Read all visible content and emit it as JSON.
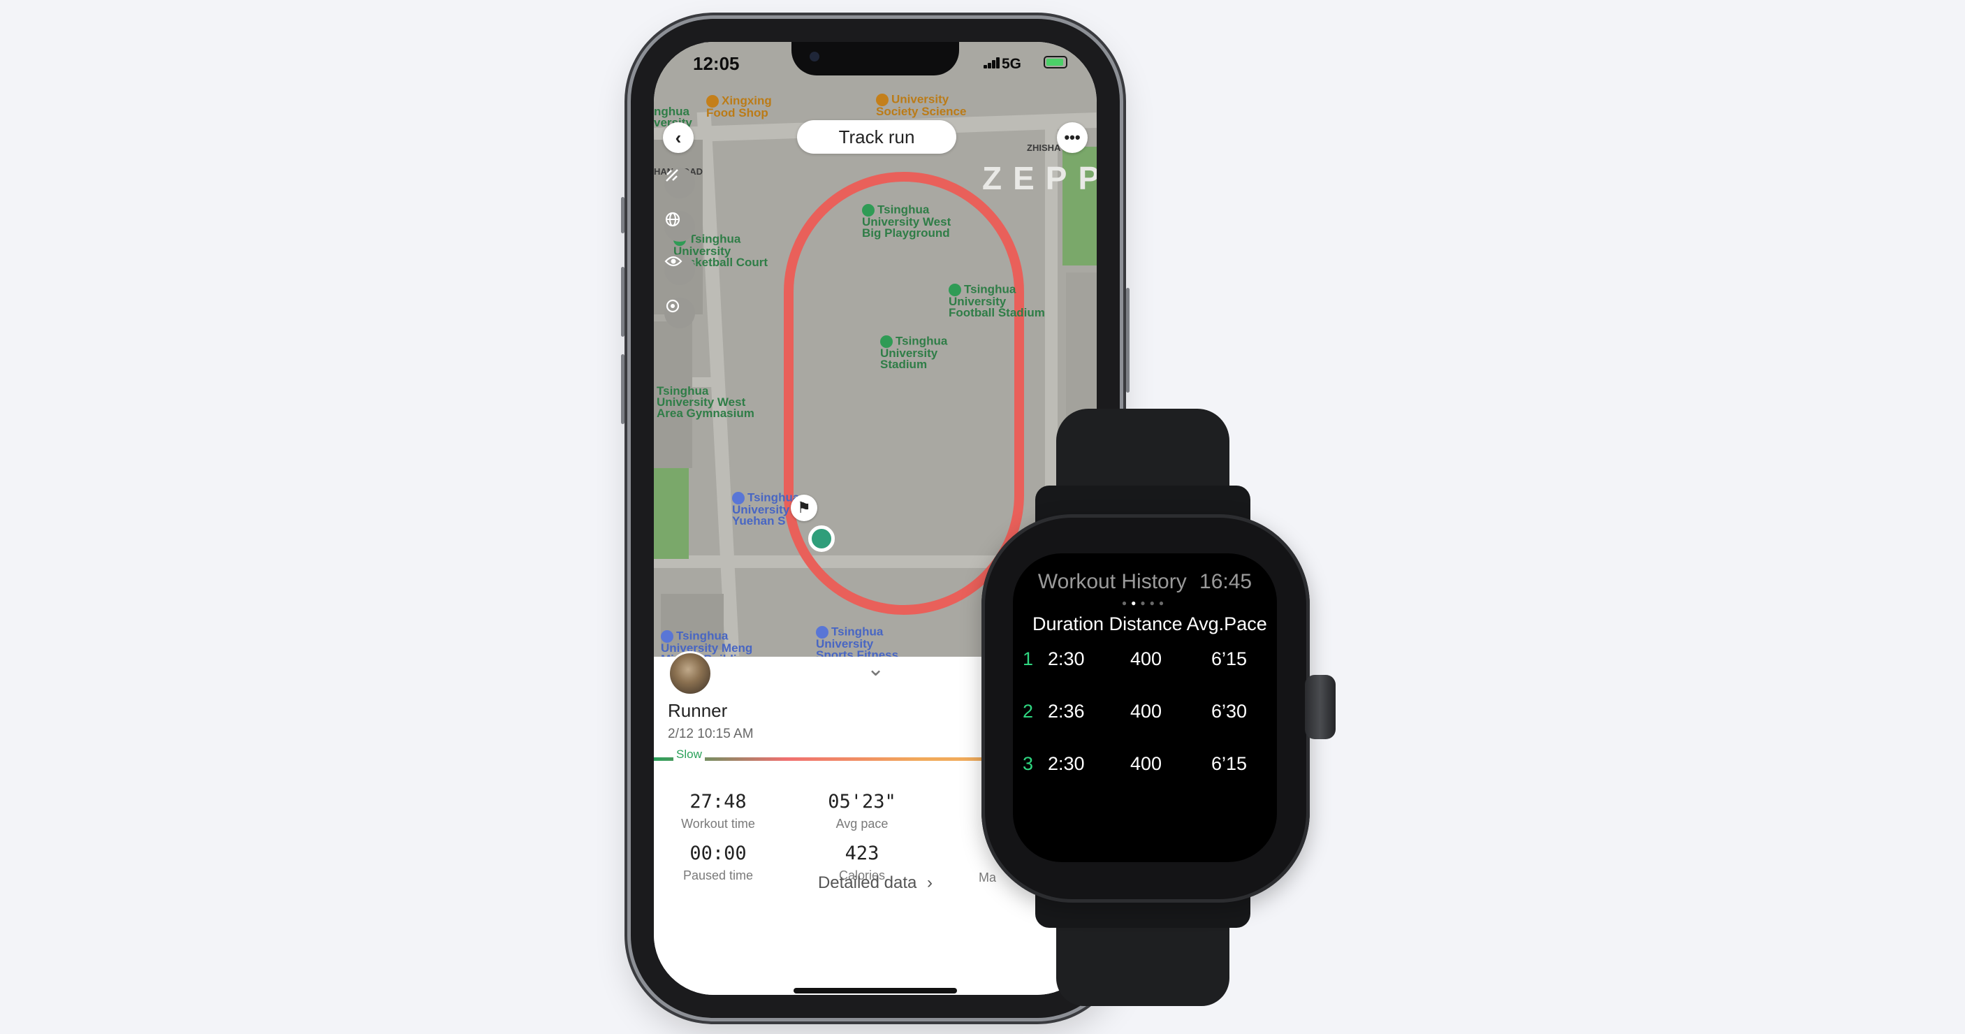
{
  "phone": {
    "status_bar": {
      "time": "12:05",
      "network": "5G"
    },
    "map": {
      "title": "Track run",
      "watermark": "ZEPP",
      "labels": {
        "food_shop": "Xingxing\nFood Shop",
        "society_science": "University\nSociety Science",
        "nghua": "nghua\nversity",
        "road": "HAN ROAD",
        "zhisha": "ZHISHA",
        "big_playground": "Tsinghua\nUniversity West\nBig Playground",
        "basketball": "Tsinghua\nUniversity\nBasketball Court",
        "football": "Tsinghua\nUniversity\nFootball Stadium",
        "stadium": "Tsinghua\nUniversity\nStadium",
        "west_gym": "Tsinghua\nUniversity West\nArea Gymnasium",
        "yuehan": "Tsinghua\nUniversity Ma\nYuehan S",
        "meng_minwei": "Tsinghua\nUniversity Meng\nMinwei Building",
        "sports_fitness": "Tsinghua\nUniversity\nSports Fitness"
      },
      "colors": {
        "track": "#e9605a",
        "map_bg": "#a9a8a2",
        "road": "#bdbcb6",
        "green": "#7aa86a"
      }
    },
    "panel": {
      "user_name": "Runner",
      "datetime": "2/12 10:15 AM",
      "pace_label": "Slow",
      "stats": [
        {
          "value": "27:48",
          "label": "Workout time"
        },
        {
          "value": "05'23\"",
          "label": "Avg pace"
        },
        {
          "value": "00:00",
          "label": "Paused time"
        },
        {
          "value": "423",
          "label": "Calories"
        }
      ],
      "detail_link": "Detailed data",
      "cut_off_label": "Ma"
    }
  },
  "watch": {
    "title": "Workout History",
    "time": "16:45",
    "headers": {
      "duration": "Duration",
      "distance": "Distance",
      "pace": "Avg.Pace"
    },
    "rows": [
      {
        "index": "1",
        "duration": "2:30",
        "distance": "400",
        "pace": "6’15"
      },
      {
        "index": "2",
        "duration": "2:36",
        "distance": "400",
        "pace": "6’30"
      },
      {
        "index": "3",
        "duration": "2:30",
        "distance": "400",
        "pace": "6’15"
      }
    ],
    "accent_color": "#2fd680"
  }
}
